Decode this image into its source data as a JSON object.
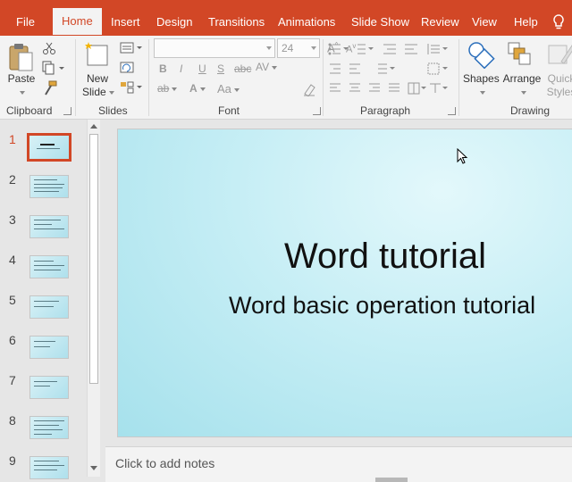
{
  "tabs": [
    {
      "label": "File",
      "active": false
    },
    {
      "label": "Home",
      "active": true
    },
    {
      "label": "Insert",
      "active": false
    },
    {
      "label": "Design",
      "active": false
    },
    {
      "label": "Transitions",
      "active": false
    },
    {
      "label": "Animations",
      "active": false
    },
    {
      "label": "Slide Show",
      "active": false
    },
    {
      "label": "Review",
      "active": false
    },
    {
      "label": "View",
      "active": false
    },
    {
      "label": "Help",
      "active": false
    }
  ],
  "ribbon": {
    "clipboard": {
      "label": "Clipboard",
      "paste": "Paste"
    },
    "slides": {
      "label": "Slides",
      "new_slide_line1": "New",
      "new_slide_line2": "Slide"
    },
    "font": {
      "label": "Font",
      "size": "24",
      "bold": "B",
      "italic": "I",
      "underline": "U",
      "strike": "S",
      "shadow": "abc",
      "spacing": "AV",
      "case": "Aa"
    },
    "paragraph": {
      "label": "Paragraph"
    },
    "drawing": {
      "label": "Drawing",
      "shapes": "Shapes",
      "arrange": "Arrange",
      "quick_styles_line1": "Quick",
      "quick_styles_line2": "Styles"
    }
  },
  "thumbnails": [
    {
      "number": "1",
      "active": true
    },
    {
      "number": "2",
      "active": false
    },
    {
      "number": "3",
      "active": false
    },
    {
      "number": "4",
      "active": false
    },
    {
      "number": "5",
      "active": false
    },
    {
      "number": "6",
      "active": false
    },
    {
      "number": "7",
      "active": false
    },
    {
      "number": "8",
      "active": false
    },
    {
      "number": "9",
      "active": false
    }
  ],
  "slide": {
    "title": "Word tutorial",
    "subtitle": "Word basic operation tutorial"
  },
  "notes": {
    "placeholder": "Click to add notes"
  },
  "colors": {
    "accent": "#d24726",
    "ribbon_bg": "#f3f3f3",
    "slide_bg": "#c6eef5"
  }
}
